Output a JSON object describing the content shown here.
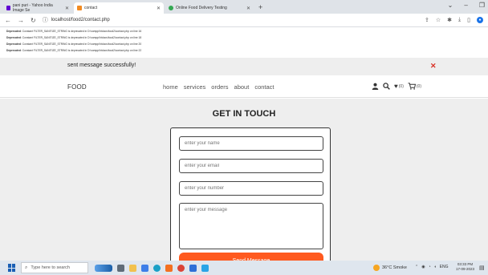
{
  "browser": {
    "tabs": [
      {
        "label": "pani puri - Yahoo India Image Se",
        "favicon_color": "#6001d2"
      },
      {
        "label": "contact",
        "favicon_color": "#f28b22"
      },
      {
        "label": "Online Food Delivery Testing",
        "favicon_color": "#34a853"
      }
    ],
    "new_tab": "+",
    "url": "localhost/food2/contact.php"
  },
  "warnings": [
    {
      "label": "Deprecated",
      "text": ": Constant FILTER_SANITIZE_STRING is deprecated in D:\\xampp\\htdocs\\food2\\contact.php on line 16"
    },
    {
      "label": "Deprecated",
      "text": ": Constant FILTER_SANITIZE_STRING is deprecated in D:\\xampp\\htdocs\\food2\\contact.php on line 18"
    },
    {
      "label": "Deprecated",
      "text": ": Constant FILTER_SANITIZE_STRING is deprecated in D:\\xampp\\htdocs\\food2\\contact.php on line 20"
    },
    {
      "label": "Deprecated",
      "text": ": Constant FILTER_SANITIZE_STRING is deprecated in D:\\xampp\\htdocs\\food2\\contact.php on line 22"
    }
  ],
  "message": {
    "text": "sent message successfully!",
    "close": "✕"
  },
  "header": {
    "logo": "FOOD",
    "menu": [
      "home",
      "services",
      "orders",
      "about",
      "contact"
    ],
    "wishlist_count": "(0)",
    "cart_count": "(0)"
  },
  "section": {
    "title": "GET IN TOUCH",
    "name_placeholder": "enter your name",
    "email_placeholder": "enter your email",
    "number_placeholder": "enter your number",
    "message_placeholder": "enter your message",
    "send_label": "Send Message",
    "accent": "#ff5a1f"
  },
  "taskbar": {
    "search_placeholder": "Type here to search",
    "weather": "36°C Smoke",
    "tray": "ENG",
    "time": "03:33 PM",
    "date": "17-09-2023"
  }
}
